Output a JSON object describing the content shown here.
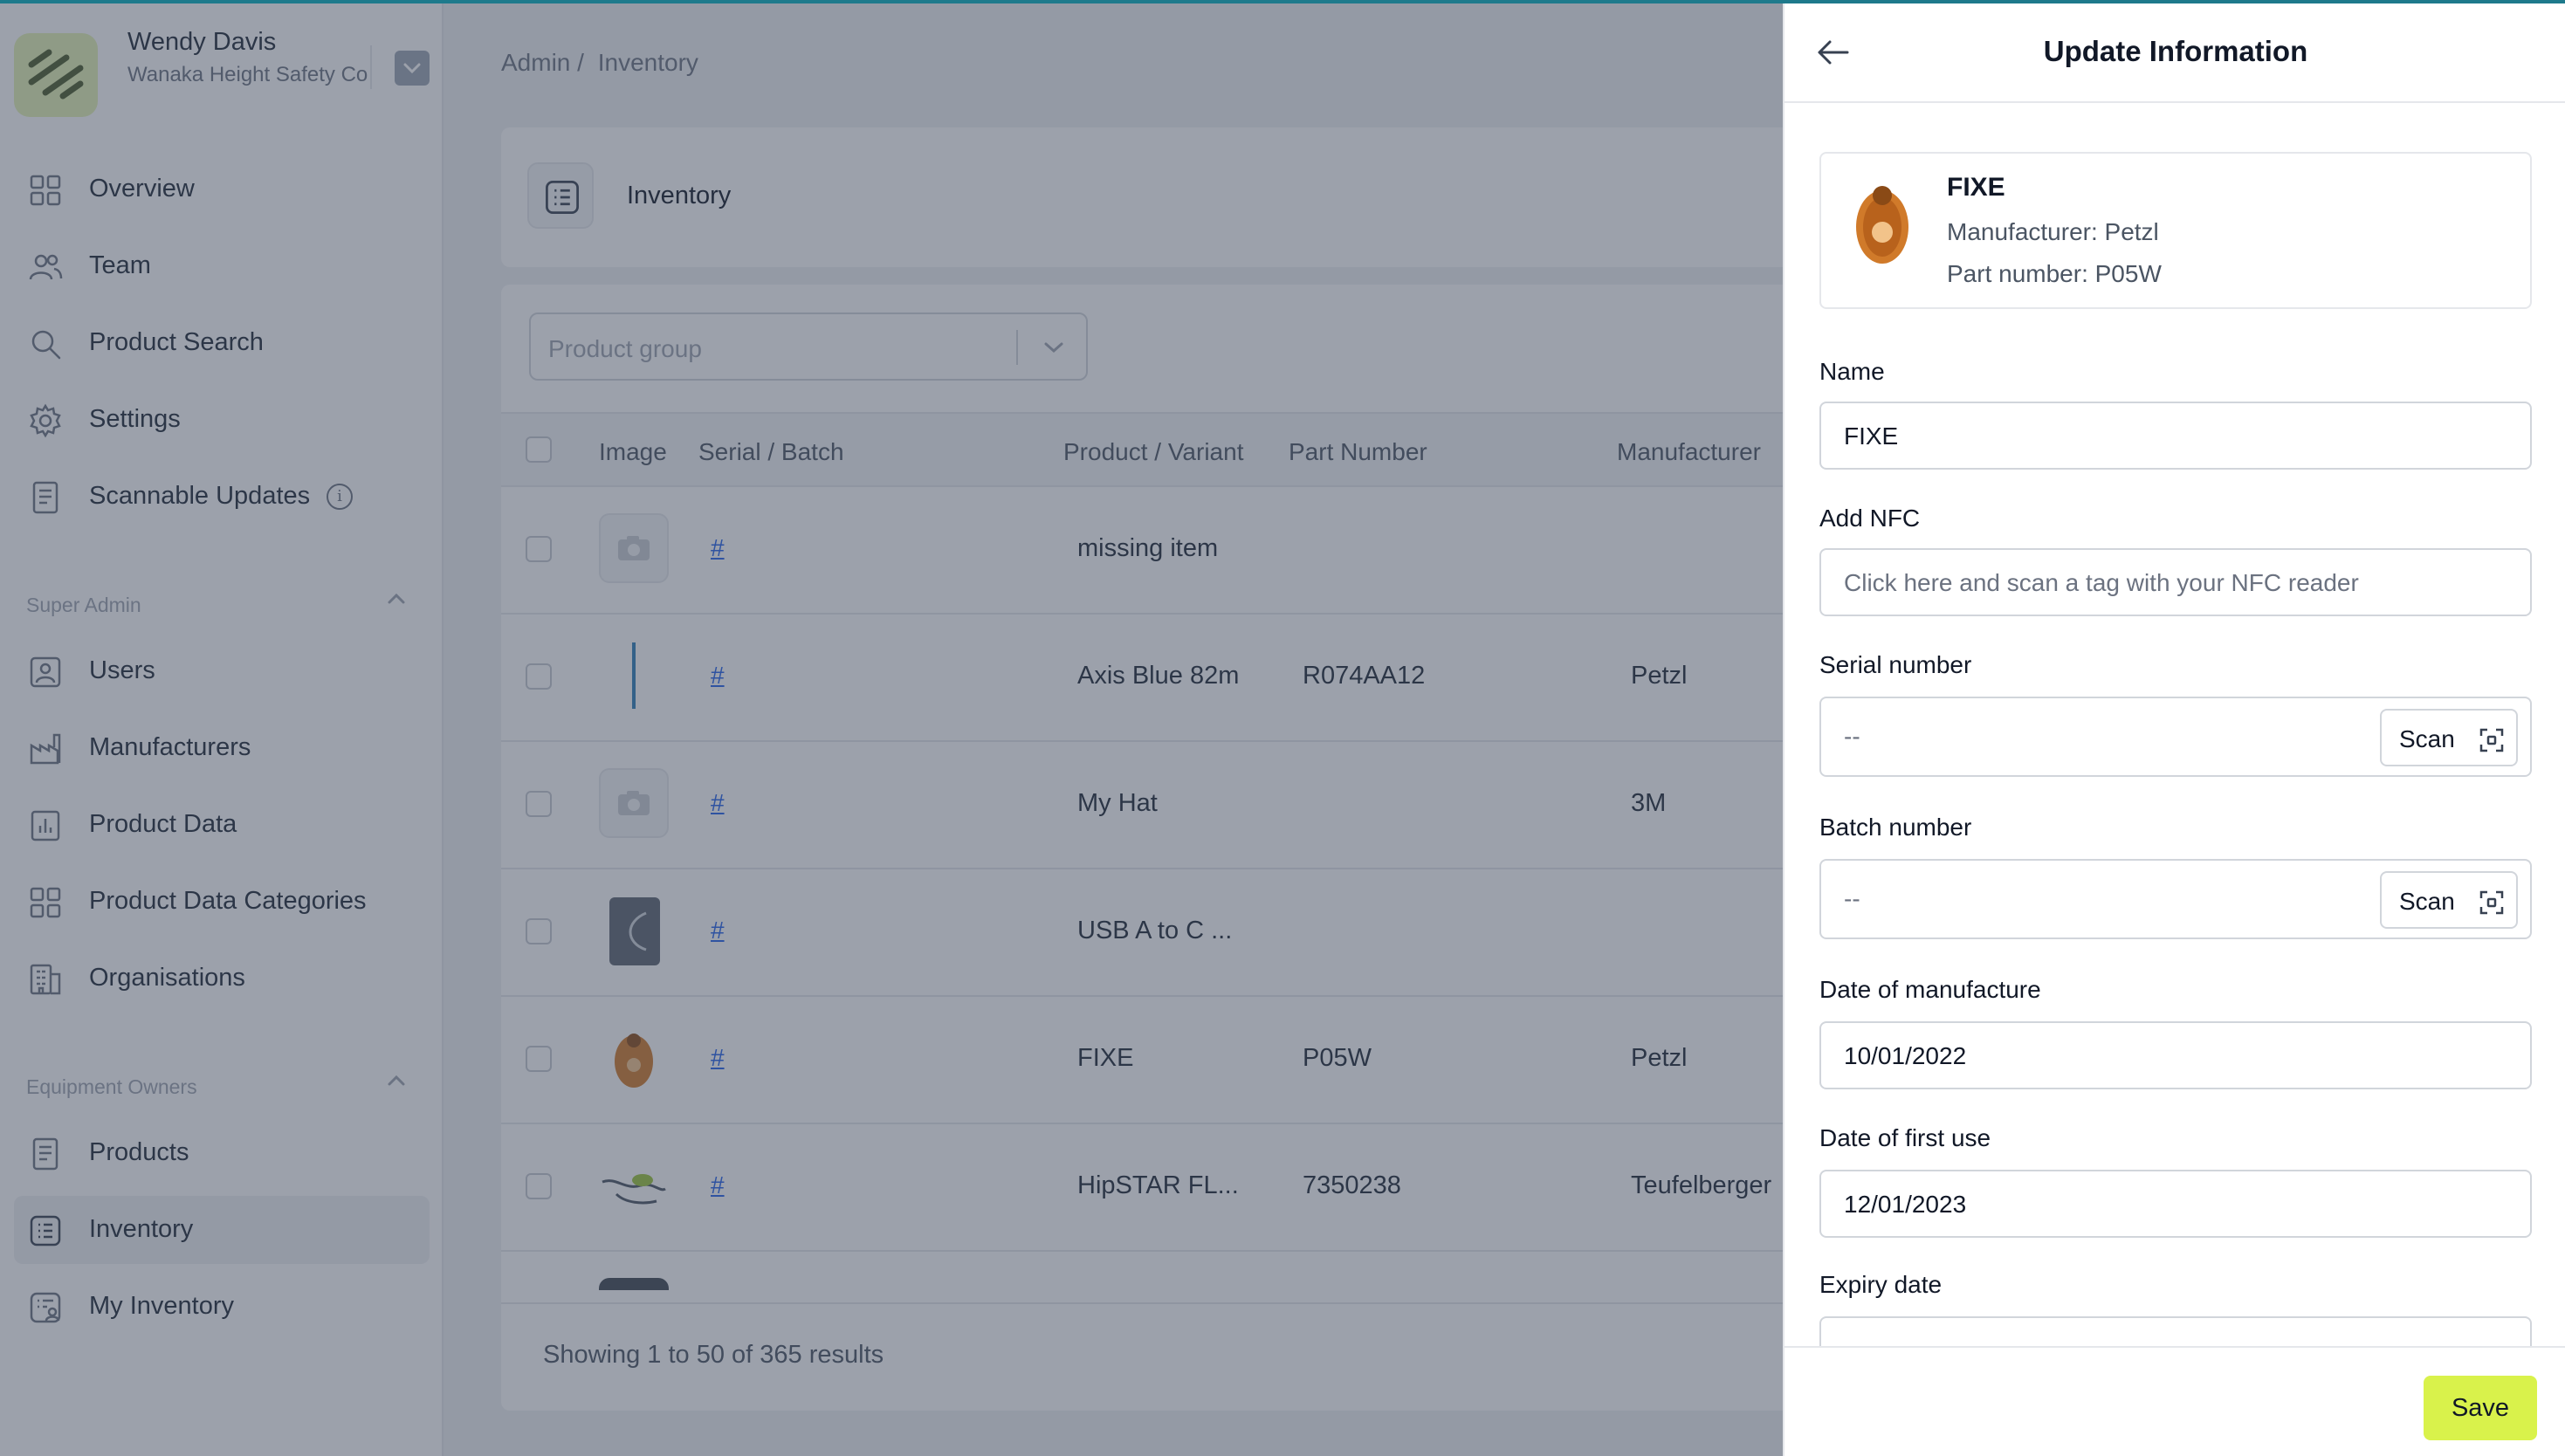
{
  "sidebar": {
    "user_name": "Wendy Davis",
    "org_name": "Wanaka Height Safety Co",
    "main_items": [
      {
        "label": "Overview",
        "icon": "grid-icon"
      },
      {
        "label": "Team",
        "icon": "users-icon"
      },
      {
        "label": "Product Search",
        "icon": "search-icon"
      },
      {
        "label": "Settings",
        "icon": "gear-icon"
      },
      {
        "label": "Scannable Updates",
        "icon": "document-icon"
      }
    ],
    "super_admin": {
      "title": "Super Admin",
      "items": [
        {
          "label": "Users",
          "icon": "user-icon"
        },
        {
          "label": "Manufacturers",
          "icon": "factory-icon"
        },
        {
          "label": "Product Data",
          "icon": "chart-icon"
        },
        {
          "label": "Product Data Categories",
          "icon": "grid-icon"
        },
        {
          "label": "Organisations",
          "icon": "building-icon"
        }
      ]
    },
    "equipment_owners": {
      "title": "Equipment Owners",
      "items": [
        {
          "label": "Products",
          "icon": "document-icon"
        },
        {
          "label": "Inventory",
          "icon": "list-icon",
          "active": true
        },
        {
          "label": "My Inventory",
          "icon": "user-list-icon"
        }
      ]
    }
  },
  "breadcrumb": {
    "root": "Admin",
    "sep": "/",
    "current": "Inventory"
  },
  "inventory": {
    "title": "Inventory",
    "filter_placeholder": "Product group",
    "columns": [
      "Image",
      "Serial / Batch",
      "Product / Variant",
      "Part Number",
      "Manufacturer"
    ],
    "rows": [
      {
        "link": "#",
        "product": "missing item",
        "part": "",
        "manufacturer": "",
        "image": "placeholder"
      },
      {
        "link": "#",
        "product": "Axis Blue 82m",
        "part": "R074AA12",
        "manufacturer": "Petzl",
        "image": "rope"
      },
      {
        "link": "#",
        "product": "My Hat",
        "part": "",
        "manufacturer": "3M",
        "image": "placeholder"
      },
      {
        "link": "#",
        "product": "USB A to C ...",
        "part": "",
        "manufacturer": "",
        "image": "cable"
      },
      {
        "link": "#",
        "product": "FIXE",
        "part": "P05W",
        "manufacturer": "Petzl",
        "image": "pulley"
      },
      {
        "link": "#",
        "product": "HipSTAR FL...",
        "part": "7350238",
        "manufacturer": "Teufelberger",
        "image": "lanyard"
      }
    ],
    "footer": "Showing 1 to 50 of 365 results"
  },
  "panel": {
    "title": "Update Information",
    "product": {
      "name": "FIXE",
      "manufacturer_line": "Manufacturer: Petzl",
      "part_line": "Part number: P05W"
    },
    "fields": {
      "name_label": "Name",
      "name_value": "FIXE",
      "nfc_label": "Add NFC",
      "nfc_placeholder": "Click here and scan a tag with your NFC reader",
      "serial_label": "Serial number",
      "serial_placeholder": "--",
      "batch_label": "Batch number",
      "batch_placeholder": "--",
      "scan_label": "Scan",
      "dom_label": "Date of manufacture",
      "dom_value": "10/01/2022",
      "dofu_label": "Date of first use",
      "dofu_value": "12/01/2023",
      "expiry_label": "Expiry date"
    },
    "save_label": "Save"
  },
  "colors": {
    "accent_save": "#d9f24b",
    "link": "#2563eb",
    "topbar": "#1e7a8c"
  }
}
